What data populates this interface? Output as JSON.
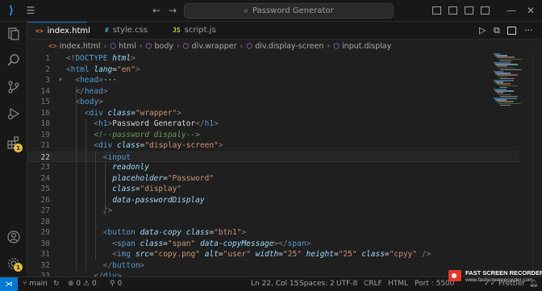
{
  "titlebar": {
    "search_placeholder": "Password Generator"
  },
  "tabs": [
    {
      "label": "index.html",
      "icon_text": "<>",
      "color": "#e37933",
      "active": true
    },
    {
      "label": "style.css",
      "icon_text": "#",
      "color": "#519aba",
      "active": false
    },
    {
      "label": "script.js",
      "icon_text": "JS",
      "color": "#cbcb41",
      "active": false
    }
  ],
  "breadcrumb": [
    "index.html",
    "html",
    "body",
    "div.wrapper",
    "div.display-screen",
    "input.display"
  ],
  "activity": {
    "extensions_badge": "1",
    "settings_badge": "1"
  },
  "editor": {
    "lines": [
      {
        "n": "1",
        "tokens": [
          [
            "t",
            "<!"
          ],
          [
            "dt",
            "DOCTYPE"
          ],
          [
            "tx",
            " "
          ],
          [
            "at",
            "html"
          ],
          [
            "t",
            ">"
          ]
        ]
      },
      {
        "n": "2",
        "tokens": [
          [
            "t",
            "<"
          ],
          [
            "tg",
            "html"
          ],
          [
            "tx",
            " "
          ],
          [
            "at",
            "lang"
          ],
          [
            "tx",
            "="
          ],
          [
            "st",
            "\"en\""
          ],
          [
            "t",
            ">"
          ]
        ]
      },
      {
        "n": "3",
        "fold": "›",
        "tokens": [
          [
            "tx",
            "  "
          ],
          [
            "t",
            "<"
          ],
          [
            "tg",
            "head"
          ],
          [
            "t",
            ">"
          ],
          [
            "tx",
            "···"
          ]
        ]
      },
      {
        "n": "14",
        "tokens": [
          [
            "tx",
            "  "
          ],
          [
            "t",
            "</"
          ],
          [
            "tg",
            "head"
          ],
          [
            "t",
            ">"
          ]
        ]
      },
      {
        "n": "15",
        "tokens": [
          [
            "tx",
            "  "
          ],
          [
            "t",
            "<"
          ],
          [
            "tg",
            "body"
          ],
          [
            "t",
            ">"
          ]
        ]
      },
      {
        "n": "16",
        "tokens": [
          [
            "tx",
            "    "
          ],
          [
            "t",
            "<"
          ],
          [
            "tg",
            "div"
          ],
          [
            "tx",
            " "
          ],
          [
            "at",
            "class"
          ],
          [
            "tx",
            "="
          ],
          [
            "st",
            "\"wrapper\""
          ],
          [
            "t",
            ">"
          ]
        ]
      },
      {
        "n": "18",
        "tokens": [
          [
            "tx",
            "      "
          ],
          [
            "t",
            "<"
          ],
          [
            "tg",
            "h1"
          ],
          [
            "t",
            ">"
          ],
          [
            "tx",
            "Password Generator"
          ],
          [
            "t",
            "</"
          ],
          [
            "tg",
            "h1"
          ],
          [
            "t",
            ">"
          ]
        ]
      },
      {
        "n": "19",
        "tokens": [
          [
            "tx",
            "      "
          ],
          [
            "cm",
            "<!--password dispaly-->"
          ]
        ]
      },
      {
        "n": "21",
        "tokens": [
          [
            "tx",
            "      "
          ],
          [
            "t",
            "<"
          ],
          [
            "tg",
            "div"
          ],
          [
            "tx",
            " "
          ],
          [
            "at",
            "class"
          ],
          [
            "tx",
            "="
          ],
          [
            "st",
            "\"display-screen\""
          ],
          [
            "t",
            ">"
          ]
        ]
      },
      {
        "n": "22",
        "current": true,
        "tokens": [
          [
            "tx",
            "        "
          ],
          [
            "t",
            "<"
          ],
          [
            "tg",
            "input"
          ]
        ]
      },
      {
        "n": "23",
        "tokens": [
          [
            "tx",
            "          "
          ],
          [
            "at",
            "readonly"
          ]
        ]
      },
      {
        "n": "24",
        "tokens": [
          [
            "tx",
            "          "
          ],
          [
            "at",
            "placeholder"
          ],
          [
            "tx",
            "="
          ],
          [
            "st",
            "\"Password\""
          ]
        ]
      },
      {
        "n": "25",
        "tokens": [
          [
            "tx",
            "          "
          ],
          [
            "at",
            "class"
          ],
          [
            "tx",
            "="
          ],
          [
            "st",
            "\"display\""
          ]
        ]
      },
      {
        "n": "26",
        "tokens": [
          [
            "tx",
            "          "
          ],
          [
            "at",
            "data-passwordDisplay"
          ]
        ]
      },
      {
        "n": "27",
        "tokens": [
          [
            "tx",
            "        "
          ],
          [
            "t",
            "/>"
          ]
        ]
      },
      {
        "n": "28",
        "tokens": []
      },
      {
        "n": "29",
        "tokens": [
          [
            "tx",
            "        "
          ],
          [
            "t",
            "<"
          ],
          [
            "tg",
            "button"
          ],
          [
            "tx",
            " "
          ],
          [
            "at",
            "data-copy"
          ],
          [
            "tx",
            " "
          ],
          [
            "at",
            "class"
          ],
          [
            "tx",
            "="
          ],
          [
            "st",
            "\"btn1\""
          ],
          [
            "t",
            ">"
          ]
        ]
      },
      {
        "n": "30",
        "tokens": [
          [
            "tx",
            "          "
          ],
          [
            "t",
            "<"
          ],
          [
            "tg",
            "span"
          ],
          [
            "tx",
            " "
          ],
          [
            "at",
            "class"
          ],
          [
            "tx",
            "="
          ],
          [
            "st",
            "\"span\""
          ],
          [
            "tx",
            " "
          ],
          [
            "at",
            "data-copyMessage"
          ],
          [
            "t",
            ">"
          ],
          [
            "t",
            "</"
          ],
          [
            "tg",
            "span"
          ],
          [
            "t",
            ">"
          ]
        ]
      },
      {
        "n": "31",
        "tokens": [
          [
            "tx",
            "          "
          ],
          [
            "t",
            "<"
          ],
          [
            "tg",
            "img"
          ],
          [
            "tx",
            " "
          ],
          [
            "at",
            "src"
          ],
          [
            "tx",
            "="
          ],
          [
            "st",
            "\"copy.png\""
          ],
          [
            "tx",
            " "
          ],
          [
            "at",
            "alt"
          ],
          [
            "tx",
            "="
          ],
          [
            "st",
            "\"user\""
          ],
          [
            "tx",
            " "
          ],
          [
            "at",
            "width"
          ],
          [
            "tx",
            "="
          ],
          [
            "st",
            "\"25\""
          ],
          [
            "tx",
            " "
          ],
          [
            "at",
            "height"
          ],
          [
            "tx",
            "="
          ],
          [
            "st",
            "\"25\""
          ],
          [
            "tx",
            " "
          ],
          [
            "at",
            "class"
          ],
          [
            "tx",
            "="
          ],
          [
            "st",
            "\"cpyy\""
          ],
          [
            "tx",
            " "
          ],
          [
            "t",
            "/>"
          ]
        ]
      },
      {
        "n": "32",
        "tokens": [
          [
            "tx",
            "        "
          ],
          [
            "t",
            "</"
          ],
          [
            "tg",
            "button"
          ],
          [
            "t",
            ">"
          ]
        ]
      },
      {
        "n": "33",
        "tokens": [
          [
            "tx",
            "      "
          ],
          [
            "t",
            "</"
          ],
          [
            "tg",
            "div"
          ],
          [
            "t",
            ">"
          ]
        ]
      }
    ]
  },
  "statusbar": {
    "branch": "main",
    "problems": "0",
    "warnings": "0",
    "sync": "0",
    "cursor": "Ln 22, Col 15",
    "spaces": "Spaces: 2",
    "encoding": "UTF-8",
    "eol": "CRLF",
    "language": "HTML",
    "port": "Port : 5500",
    "prettier": "Prettier"
  },
  "recorder": {
    "title": "FAST SCREEN RECORDER",
    "url": "www.fastscreenrecorder.com"
  },
  "colors": {
    "accent": "#0078d4",
    "tag": "#569cd6",
    "attribute": "#9cdcfe",
    "string": "#ce9178",
    "comment": "#6a9955",
    "badge": "#e5b93b"
  }
}
